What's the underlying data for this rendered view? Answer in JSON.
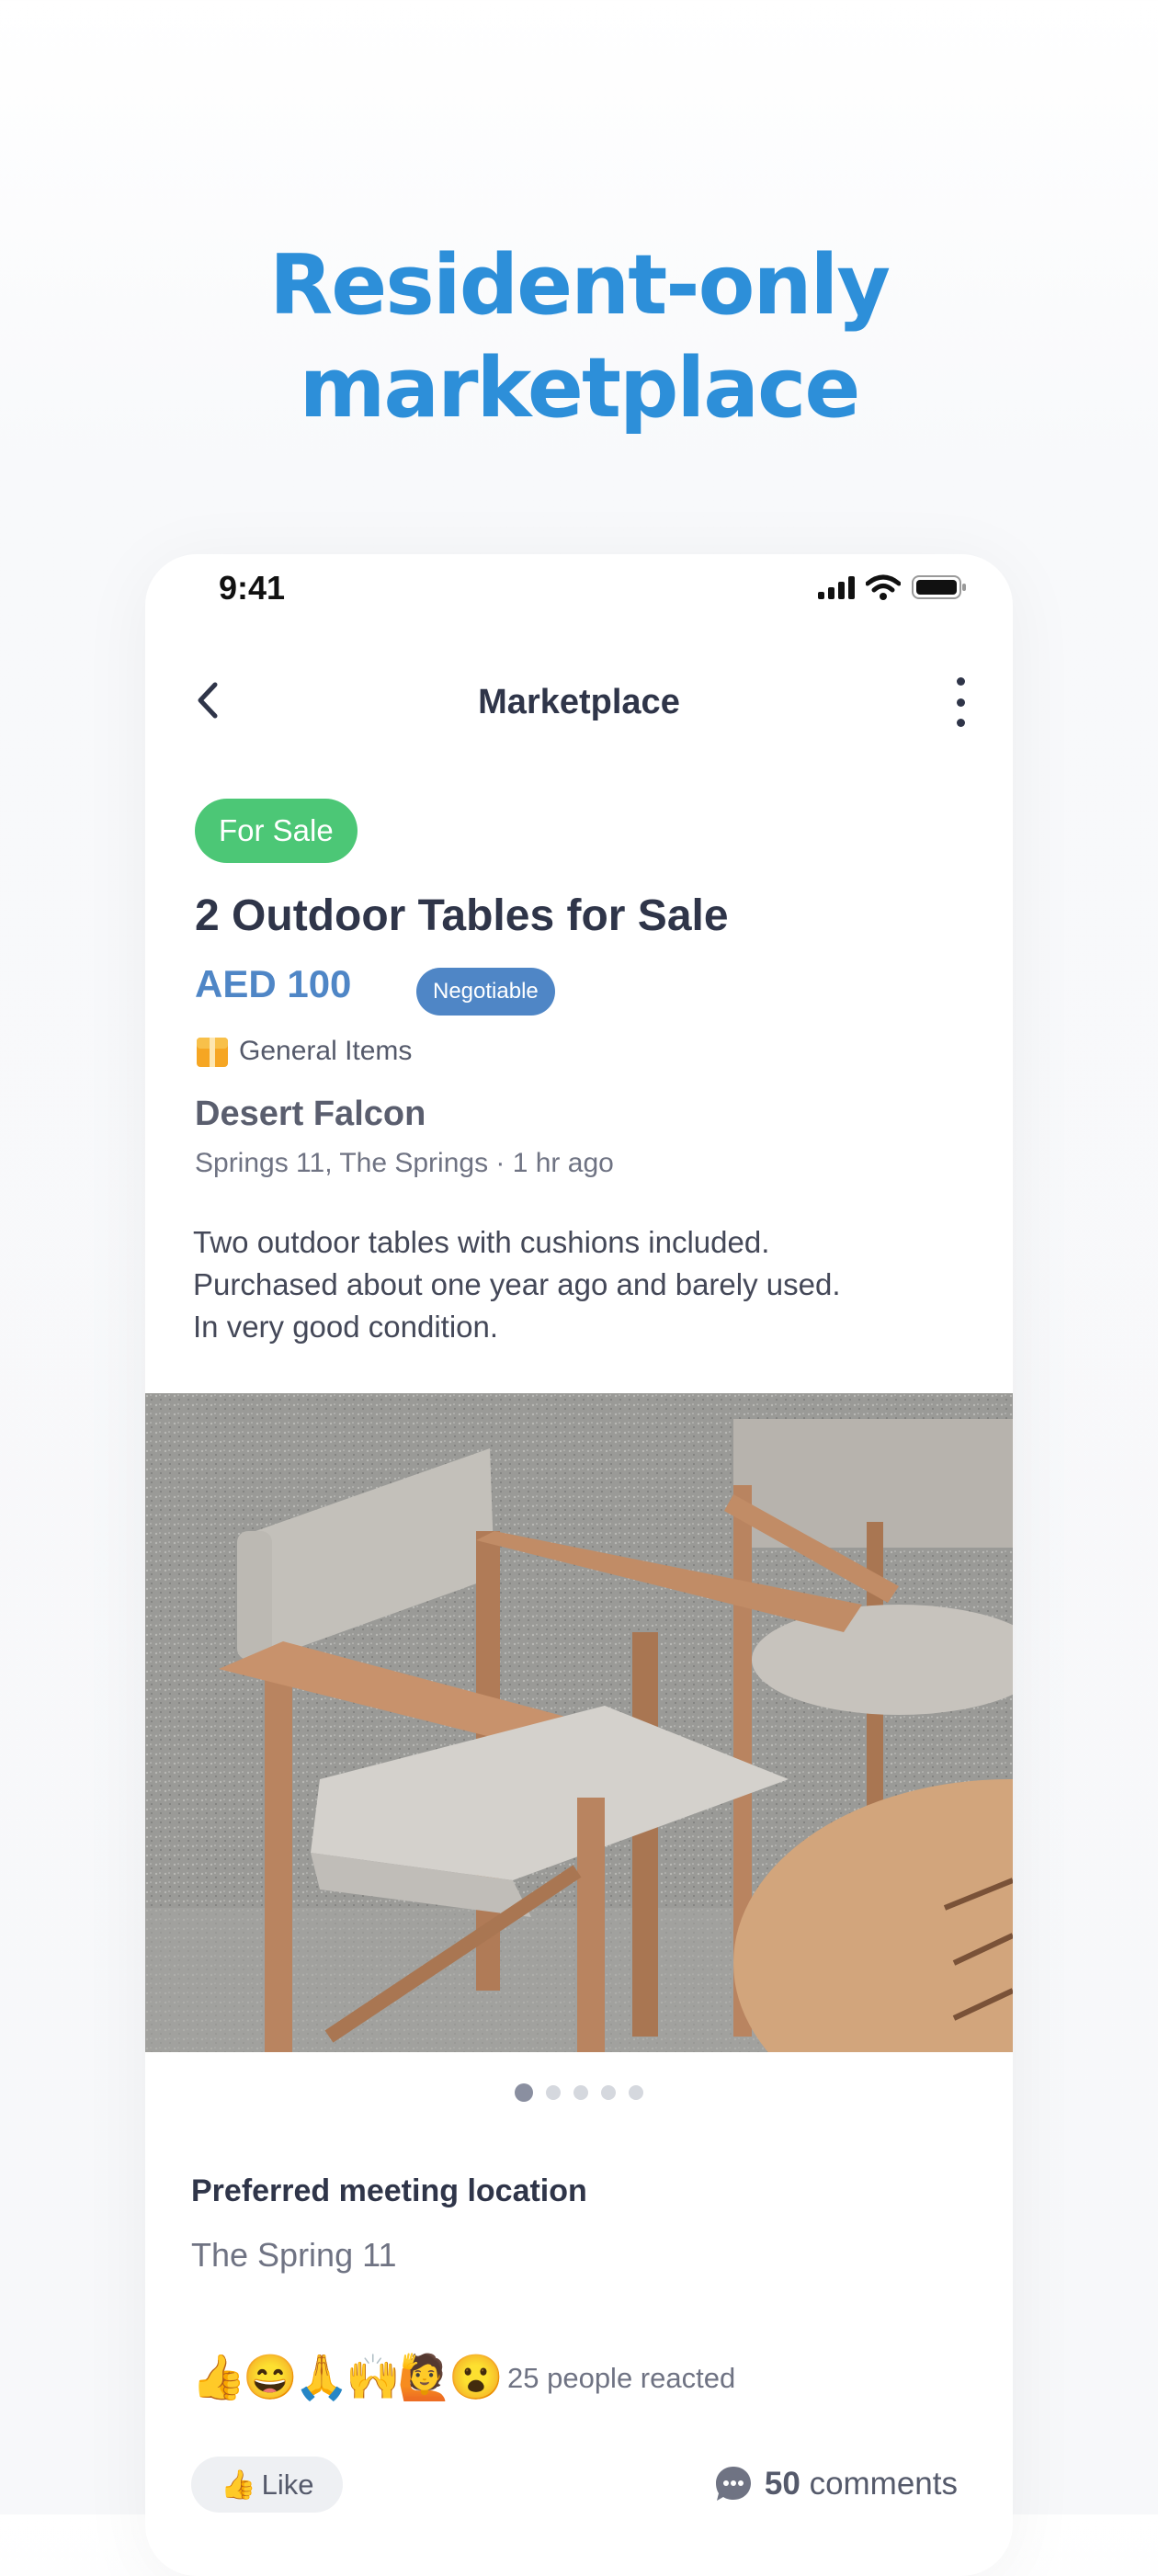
{
  "headline": {
    "line1": "Resident-only",
    "line2": "marketplace"
  },
  "status_bar": {
    "time": "9:41"
  },
  "nav": {
    "title": "Marketplace",
    "back_icon": "chevron-left-icon",
    "menu_icon": "kebab-menu-icon"
  },
  "listing": {
    "tag": "For Sale",
    "title": "2 Outdoor Tables for Sale",
    "price": "AED 100",
    "negotiable": "Negotiable",
    "category": "General Items",
    "category_icon": "box-icon",
    "seller": "Desert Falcon",
    "location": "Springs 11, The Springs · 1 hr ago",
    "description": [
      "Two outdoor tables with cushions included.",
      "Purchased about one year ago and barely used.",
      "In very good condition."
    ]
  },
  "gallery": {
    "total": 5,
    "current": 1
  },
  "meeting": {
    "label": "Preferred meeting location",
    "value": "The Spring 11"
  },
  "reactions": {
    "emojis": [
      "👍",
      "😄",
      "🙏",
      "🙌",
      "🙋",
      "😮"
    ],
    "text": "25 people reacted"
  },
  "actions": {
    "like_emoji": "👍",
    "like": "Like",
    "comments_count": "50",
    "comments_label": "comments"
  },
  "colors": {
    "brand_blue": "#2d8fd9",
    "sale_green": "#4cc776",
    "price_blue": "#4f86c6"
  }
}
